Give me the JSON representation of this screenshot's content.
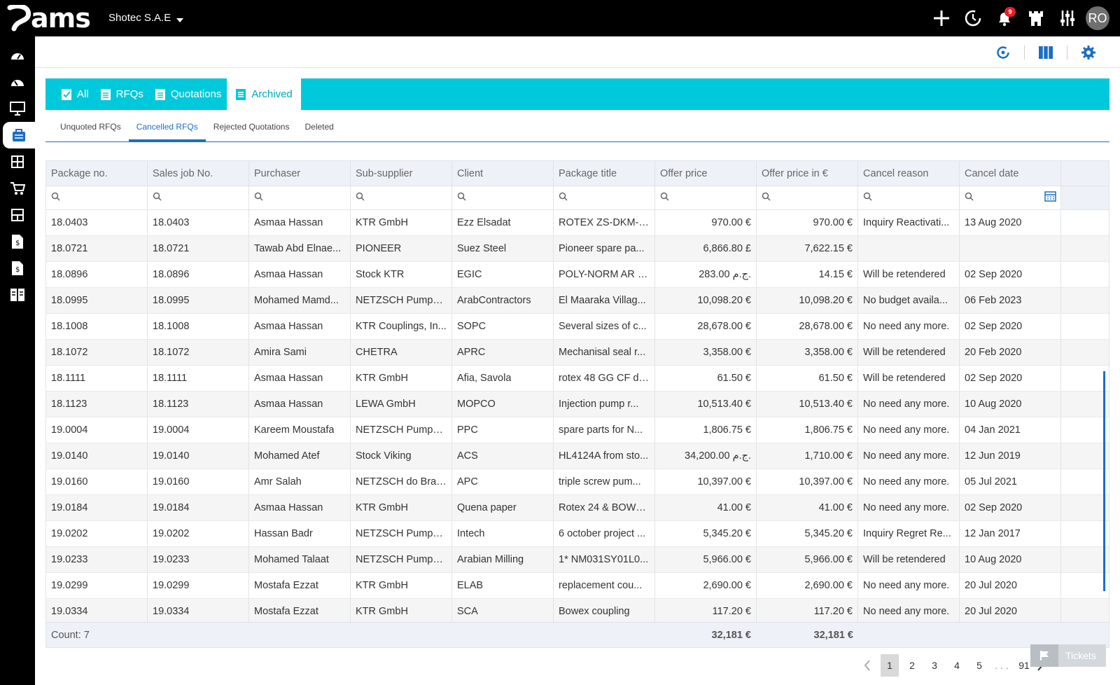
{
  "app": {
    "logo": "ams",
    "company": "Shotec S.A.E",
    "avatar_initials": "RO",
    "notification_count": "9"
  },
  "tabs": [
    {
      "label": "All"
    },
    {
      "label": "RFQs"
    },
    {
      "label": "Quotations"
    },
    {
      "label": "Archived"
    }
  ],
  "subtabs": [
    {
      "label": "Unquoted RFQs"
    },
    {
      "label": "Cancelled RFQs"
    },
    {
      "label": "Rejected Quotations"
    },
    {
      "label": "Deleted"
    }
  ],
  "columns": [
    "Package no.",
    "Sales job No.",
    "Purchaser",
    "Sub-supplier",
    "Client",
    "Package title",
    "Offer price",
    "Offer price in €",
    "Cancel reason",
    "Cancel date"
  ],
  "rows": [
    [
      "18.0403",
      "18.0403",
      "Asmaa Hassan",
      "KTR GmbH",
      "Ezz Elsadat",
      "ROTEX ZS-DKM-H...",
      "970.00 €",
      "970.00 €",
      "Inquiry Reactivati...",
      "13 Aug 2020"
    ],
    [
      "18.0721",
      "18.0721",
      "Tawab Abd Elnae...",
      "PIONEER",
      "Suez Steel",
      "Pioneer spare pa...",
      "6,866.80 £",
      "7,622.15 €",
      "",
      ""
    ],
    [
      "18.0896",
      "18.0896",
      "Asmaa Hassan",
      "Stock KTR",
      "EGIC",
      "POLY-NORM AR 1...",
      "283.00 ج.م.",
      "14.15 €",
      "Will be retendered",
      "02 Sep 2020"
    ],
    [
      "18.0995",
      "18.0995",
      "Mohamed Mamd...",
      "NETZSCH Pumpe...",
      "ArabContractors",
      "El Maaraka Villag...",
      "10,098.20 €",
      "10,098.20 €",
      "No budget availa...",
      "06 Feb 2023"
    ],
    [
      "18.1008",
      "18.1008",
      "Asmaa Hassan",
      "KTR Couplings, In...",
      "SOPC",
      "Several sizes of c...",
      "28,678.00 €",
      "28,678.00 €",
      "No need any more.",
      "02 Sep 2020"
    ],
    [
      "18.1072",
      "18.1072",
      "Amira Sami",
      "CHETRA",
      "APRC",
      "Mechanisal seal r...",
      "3,358.00 €",
      "3,358.00 €",
      "Will be retendered",
      "20 Feb 2020"
    ],
    [
      "18.1111",
      "18.1111",
      "Asmaa Hassan",
      "KTR GmbH",
      "Afia, Savola",
      "rotex 48 GG CF de...",
      "61.50 €",
      "61.50 €",
      "Will be retendered",
      "02 Sep 2020"
    ],
    [
      "18.1123",
      "18.1123",
      "Asmaa Hassan",
      "LEWA GmbH",
      "MOPCO",
      "Injection pump r...",
      "10,513.40 €",
      "10,513.40 €",
      "No need any more.",
      "10 Aug 2020"
    ],
    [
      "19.0004",
      "19.0004",
      "Kareem Moustafa",
      "NETZSCH Pumpe...",
      "PPC",
      "spare parts for N...",
      "1,806.75 €",
      "1,806.75 €",
      "No need any more.",
      "04 Jan 2021"
    ],
    [
      "19.0140",
      "19.0140",
      "Mohamed Atef",
      "Stock Viking",
      "ACS",
      "HL4124A from sto...",
      "34,200.00 ج.م.",
      "1,710.00 €",
      "No need any more.",
      "12 Jun 2019"
    ],
    [
      "19.0160",
      "19.0160",
      "Amr Salah",
      "NETZSCH do Bras...",
      "APC",
      "triple screw pum...",
      "10,397.00 €",
      "10,397.00 €",
      "No need any more.",
      "05 Jul 2021"
    ],
    [
      "19.0184",
      "19.0184",
      "Asmaa Hassan",
      "KTR GmbH",
      "Quena paper",
      "Rotex 24 & BOWE...",
      "41.00 €",
      "41.00 €",
      "No need any more.",
      "02 Sep 2020"
    ],
    [
      "19.0202",
      "19.0202",
      "Hassan Badr",
      "NETZSCH Pumpe...",
      "Intech",
      "6 october project ...",
      "5,345.20 €",
      "5,345.20 €",
      "Inquiry Regret Re...",
      "12 Jan 2017"
    ],
    [
      "19.0233",
      "19.0233",
      "Mohamed Talaat",
      "NETZSCH Pumpe...",
      "Arabian Milling",
      "1* NM031SY01L0...",
      "5,966.00 €",
      "5,966.00 €",
      "Will be retendered",
      "10 Aug 2020"
    ],
    [
      "19.0299",
      "19.0299",
      "Mostafa Ezzat",
      "KTR GmbH",
      "ELAB",
      "replacement cou...",
      "2,690.00 €",
      "2,690.00 €",
      "No need any more.",
      "20 Jul 2020"
    ],
    [
      "19.0334",
      "19.0334",
      "Mostafa Ezzat",
      "KTR GmbH",
      "SCA",
      "Bowex coupling",
      "117.20 €",
      "117.20 €",
      "No need any more.",
      "20 Jul 2020"
    ]
  ],
  "footer": {
    "count": "Count: 7",
    "offer_total": "32,181 €",
    "offer_eur_total": "32,181 €"
  },
  "pagination": {
    "pages": [
      "1",
      "2",
      "3",
      "4",
      "5"
    ],
    "ellipsis": ". . .",
    "last": "91",
    "current": "1"
  },
  "tickets": {
    "label": "Tickets"
  },
  "colors": {
    "accent": "#00c9dc",
    "link": "#1b6fc2",
    "topbar": "#000000"
  }
}
